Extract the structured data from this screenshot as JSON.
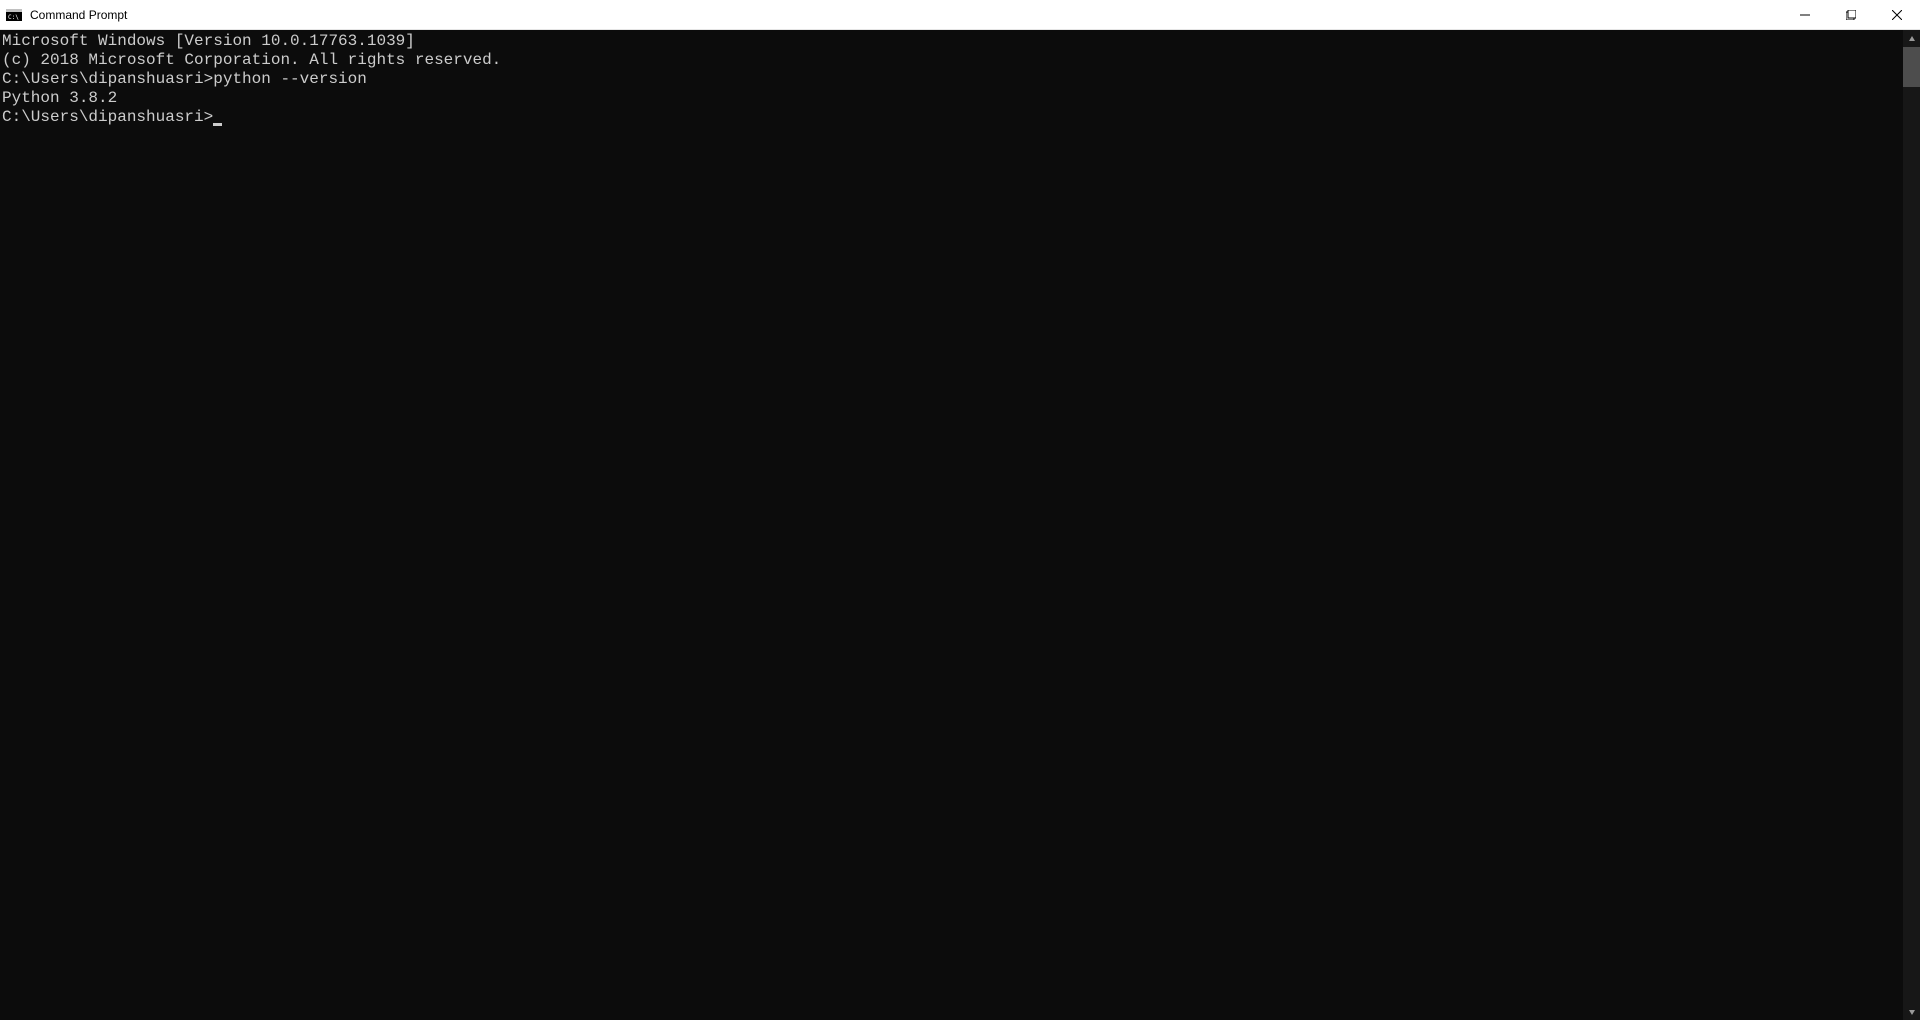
{
  "window": {
    "title": "Command Prompt"
  },
  "terminal": {
    "line1": "Microsoft Windows [Version 10.0.17763.1039]",
    "line2": "(c) 2018 Microsoft Corporation. All rights reserved.",
    "blank1": "",
    "prompt1": "C:\\Users\\dipanshuasri>python --version",
    "output1": "Python 3.8.2",
    "blank2": "",
    "prompt2": "C:\\Users\\dipanshuasri>"
  }
}
